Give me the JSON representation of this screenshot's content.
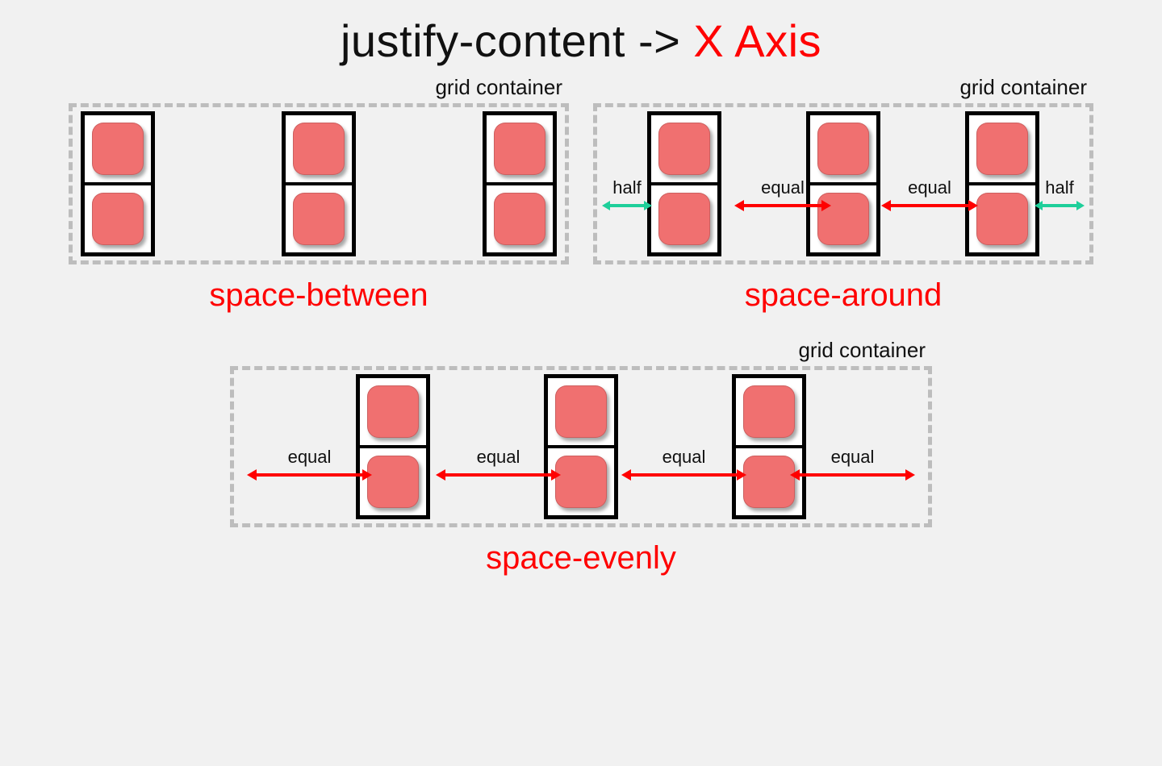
{
  "title": {
    "property": "justify-content",
    "arrow": "->",
    "axis": "X Axis"
  },
  "container_label": "grid container",
  "captions": {
    "between": "space-between",
    "around": "space-around",
    "evenly": "space-evenly"
  },
  "colors": {
    "accent": "#f00",
    "tile": "#f07070",
    "dash": "#bdbdbd",
    "half_arrow": "#1ecf9a",
    "equal_arrow": "#f00"
  },
  "around_annotations": {
    "half_left": {
      "label": "half",
      "color": "green"
    },
    "equal_mid1": {
      "label": "equal",
      "color": "red"
    },
    "equal_mid2": {
      "label": "equal",
      "color": "red"
    },
    "half_right": {
      "label": "half",
      "color": "green"
    }
  },
  "evenly_annotations": {
    "eq1": {
      "label": "equal"
    },
    "eq2": {
      "label": "equal"
    },
    "eq3": {
      "label": "equal"
    },
    "eq4": {
      "label": "equal"
    }
  }
}
